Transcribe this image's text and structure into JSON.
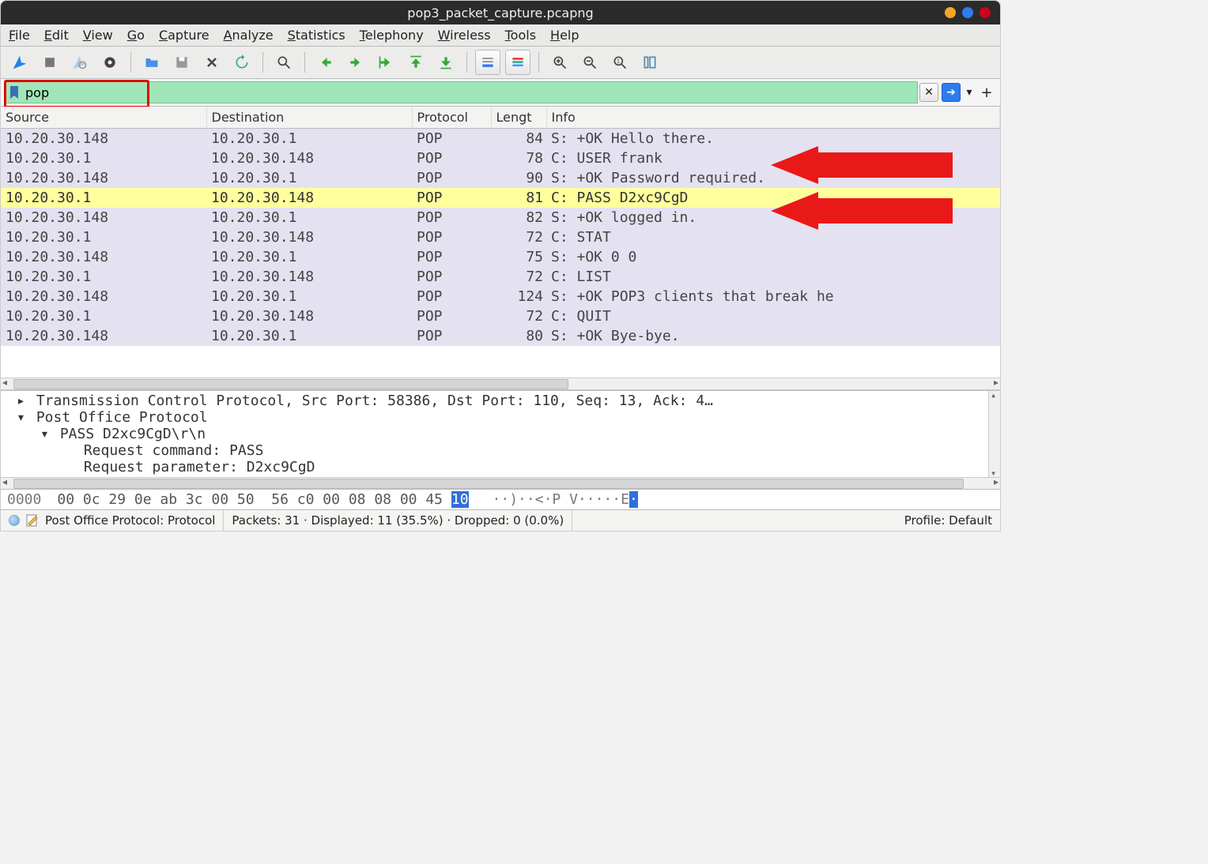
{
  "title": "pop3_packet_capture.pcapng",
  "menus": [
    "File",
    "Edit",
    "View",
    "Go",
    "Capture",
    "Analyze",
    "Statistics",
    "Telephony",
    "Wireless",
    "Tools",
    "Help"
  ],
  "filter_value": "pop",
  "columns": [
    "Source",
    "Destination",
    "Protocol",
    "Lengt",
    "Info"
  ],
  "packets": [
    {
      "src": "10.20.30.148",
      "dst": "10.20.30.1",
      "proto": "POP",
      "len": "84",
      "info": "S: +OK Hello there.",
      "hl": "purple",
      "arrow": false
    },
    {
      "src": "10.20.30.1",
      "dst": "10.20.30.148",
      "proto": "POP",
      "len": "78",
      "info": "C: USER frank",
      "hl": "purple",
      "arrow": true
    },
    {
      "src": "10.20.30.148",
      "dst": "10.20.30.1",
      "proto": "POP",
      "len": "90",
      "info": "S: +OK Password required.",
      "hl": "purple",
      "arrow": false
    },
    {
      "src": "10.20.30.1",
      "dst": "10.20.30.148",
      "proto": "POP",
      "len": "81",
      "info": "C: PASS D2xc9CgD",
      "hl": "yellow",
      "arrow": true
    },
    {
      "src": "10.20.30.148",
      "dst": "10.20.30.1",
      "proto": "POP",
      "len": "82",
      "info": "S: +OK logged in.",
      "hl": "purple",
      "arrow": false
    },
    {
      "src": "10.20.30.1",
      "dst": "10.20.30.148",
      "proto": "POP",
      "len": "72",
      "info": "C: STAT",
      "hl": "purple",
      "arrow": false
    },
    {
      "src": "10.20.30.148",
      "dst": "10.20.30.1",
      "proto": "POP",
      "len": "75",
      "info": "S: +OK 0 0",
      "hl": "purple",
      "arrow": false
    },
    {
      "src": "10.20.30.1",
      "dst": "10.20.30.148",
      "proto": "POP",
      "len": "72",
      "info": "C: LIST",
      "hl": "purple",
      "arrow": false
    },
    {
      "src": "10.20.30.148",
      "dst": "10.20.30.1",
      "proto": "POP",
      "len": "124",
      "info": "S: +OK POP3 clients that break he",
      "hl": "purple",
      "arrow": false
    },
    {
      "src": "10.20.30.1",
      "dst": "10.20.30.148",
      "proto": "POP",
      "len": "72",
      "info": "C: QUIT",
      "hl": "purple",
      "arrow": false
    },
    {
      "src": "10.20.30.148",
      "dst": "10.20.30.1",
      "proto": "POP",
      "len": "80",
      "info": "S: +OK Bye-bye.",
      "hl": "purple",
      "arrow": false
    }
  ],
  "details": [
    {
      "indent": 0,
      "tri": "▸",
      "text": "Transmission Control Protocol, Src Port: 58386, Dst Port: 110, Seq: 13, Ack: 4…"
    },
    {
      "indent": 0,
      "tri": "▾",
      "text": "Post Office Protocol"
    },
    {
      "indent": 1,
      "tri": "▾",
      "text": "PASS D2xc9CgD\\r\\n"
    },
    {
      "indent": 2,
      "tri": "",
      "text": "Request command: PASS"
    },
    {
      "indent": 2,
      "tri": "",
      "text": "Request parameter: D2xc9CgD"
    }
  ],
  "hex": {
    "offset": "0000",
    "bytes": [
      "00",
      "0c",
      "29",
      "0e",
      "ab",
      "3c",
      "00",
      "50",
      "",
      "56",
      "c0",
      "00",
      "08",
      "08",
      "00",
      "45",
      "10"
    ],
    "sel_index": 16,
    "ascii_pre": "··)··<·P V·····E",
    "ascii_sel": "·"
  },
  "status": {
    "field": "Post Office Protocol: Protocol",
    "packets": "Packets: 31 · Displayed: 11 (35.5%) · Dropped: 0 (0.0%)",
    "profile": "Profile: Default"
  }
}
